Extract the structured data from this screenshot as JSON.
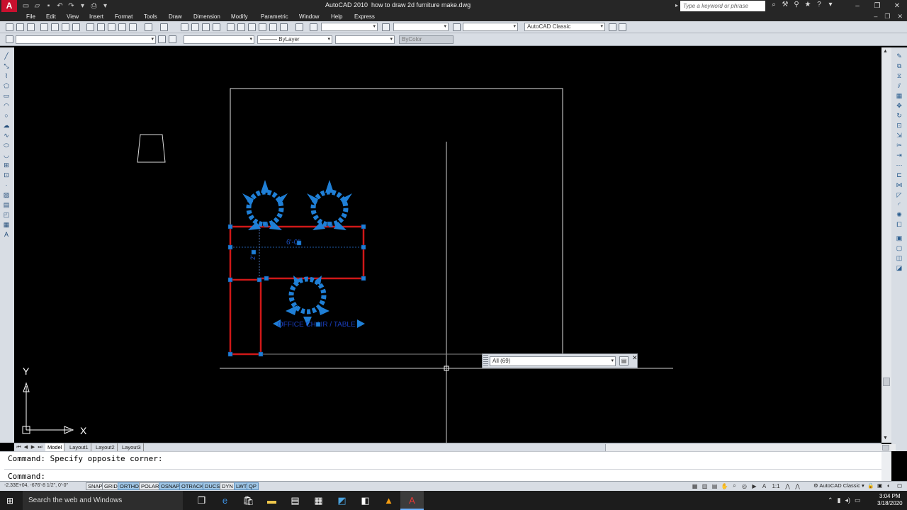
{
  "titlebar": {
    "app_logo": "A",
    "app_name": "AutoCAD 2010",
    "file_name": "how to draw 2d furniture make.dwg",
    "search_placeholder": "Type a keyword or phrase"
  },
  "menus": [
    "File",
    "Edit",
    "View",
    "Insert",
    "Format",
    "Tools",
    "Draw",
    "Dimension",
    "Modify",
    "Parametric",
    "Window",
    "Help",
    "Express"
  ],
  "toolbar": {
    "workspace": "AutoCAD Classic",
    "linetype": "ByLayer",
    "plot_style": "ByColor"
  },
  "drawing": {
    "labels": {
      "dim_label": "6'-0\"",
      "side_label": "2'",
      "table_label": "OFFICE CHAIR / TABLE"
    },
    "selection_combo": "All (69)",
    "ucs": {
      "y": "Y",
      "x": "X"
    }
  },
  "layout_tabs": [
    {
      "label": "Model",
      "active": true
    },
    {
      "label": "Layout1",
      "active": false
    },
    {
      "label": "Layout2",
      "active": false
    },
    {
      "label": "Layout3",
      "active": false
    }
  ],
  "command": {
    "history": "Command: Specify opposite corner:",
    "prompt": "Command:"
  },
  "status": {
    "coords": "-2.33E+04, -676'-8 1/2\", 0'-0\"",
    "toggles": [
      {
        "label": "SNAP",
        "on": false
      },
      {
        "label": "GRID",
        "on": false
      },
      {
        "label": "ORTHO",
        "on": true
      },
      {
        "label": "POLAR",
        "on": false
      },
      {
        "label": "OSNAP",
        "on": true
      },
      {
        "label": "OTRACK",
        "on": true
      },
      {
        "label": "DUCS",
        "on": true
      },
      {
        "label": "DYN",
        "on": false
      },
      {
        "label": "LWT",
        "on": true
      },
      {
        "label": "QP",
        "on": true
      }
    ],
    "annotation_scale": "1:1",
    "workspace": "AutoCAD Classic"
  },
  "taskbar": {
    "search_placeholder": "Search the web and Windows",
    "time": "3:04 PM",
    "date": "3/18/2020"
  }
}
